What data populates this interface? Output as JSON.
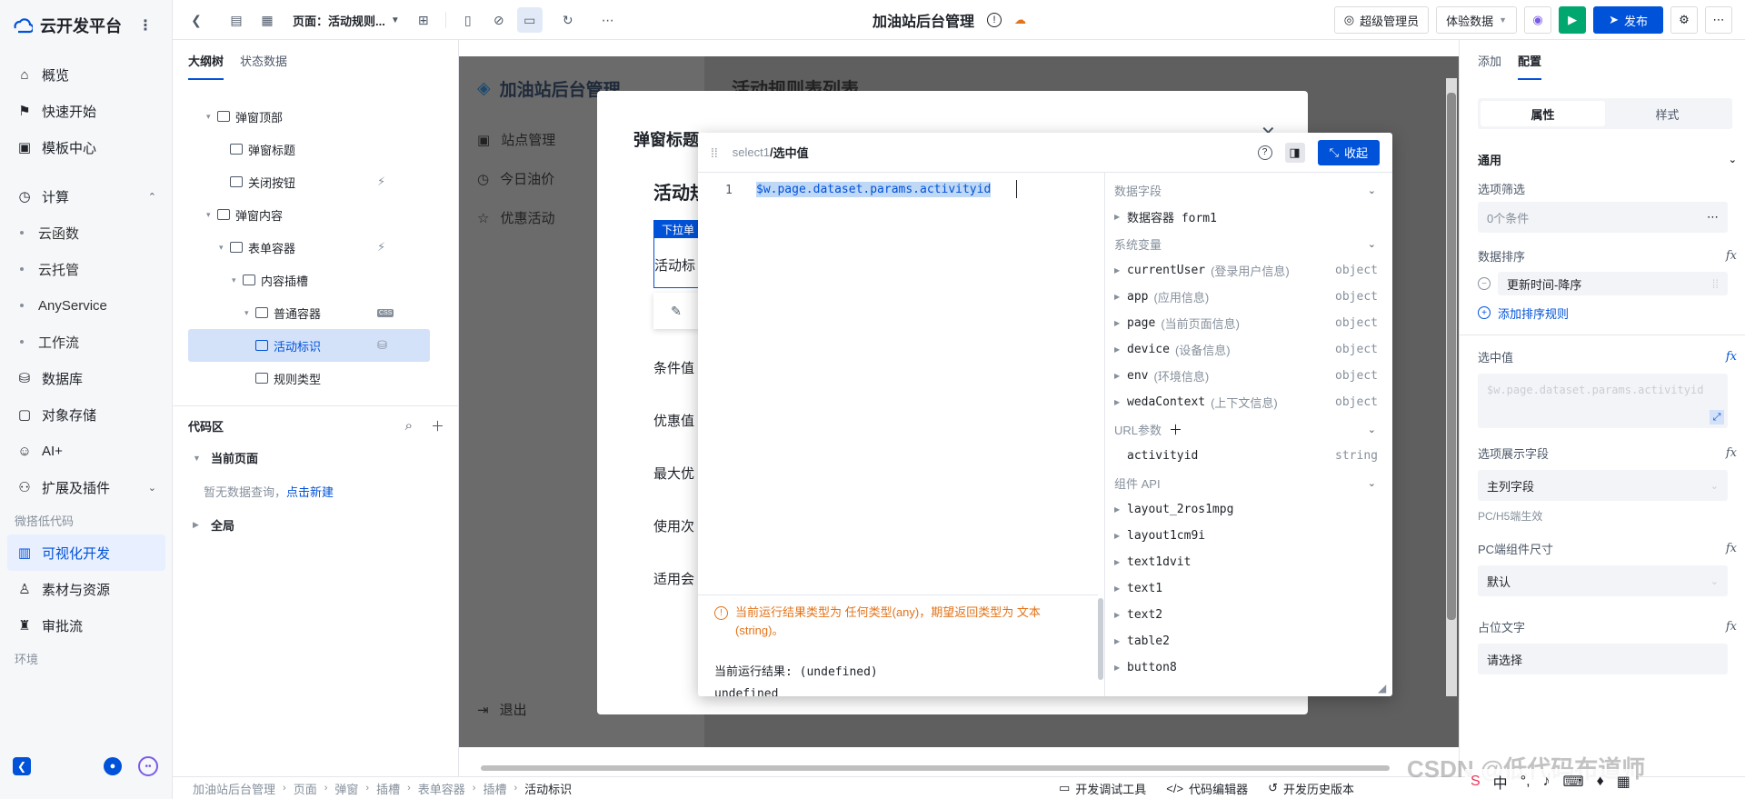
{
  "app": {
    "name": "云开发平台"
  },
  "nav": {
    "items": [
      {
        "label": "概览",
        "icon": "home-icon"
      },
      {
        "label": "快速开始",
        "icon": "flag-icon"
      },
      {
        "label": "模板中心",
        "icon": "template-icon"
      }
    ],
    "compute": {
      "label": "计算",
      "icon": "compute-icon"
    },
    "compute_sub": [
      "云函数",
      "云托管",
      "AnyService",
      "工作流"
    ],
    "items2": [
      {
        "label": "数据库",
        "icon": "database-icon"
      },
      {
        "label": "对象存储",
        "icon": "storage-icon"
      },
      {
        "label": "AI+",
        "icon": "robot-icon"
      },
      {
        "label": "扩展及插件",
        "icon": "plugin-icon"
      }
    ],
    "section_lowcode": "微搭低代码",
    "lowcode": [
      {
        "label": "可视化开发",
        "icon": "layout-icon",
        "active": true
      },
      {
        "label": "素材与资源",
        "icon": "user-icon"
      },
      {
        "label": "审批流",
        "icon": "stamp-icon"
      }
    ],
    "section_env": "环境"
  },
  "toolbar": {
    "page_label": "页面：活动规则...",
    "title": "加油站后台管理",
    "user_label": "超级管理员",
    "data_label": "体验数据",
    "publish_label": "发布"
  },
  "outline": {
    "tabs": [
      "大纲树",
      "状态数据"
    ],
    "tree": [
      {
        "label": "弹窗顶部",
        "indent": 0,
        "caret": true
      },
      {
        "label": "弹窗标题",
        "indent": 1,
        "caret": false
      },
      {
        "label": "关闭按钮",
        "indent": 1,
        "caret": false,
        "badge": "bolt"
      },
      {
        "label": "弹窗内容",
        "indent": 0,
        "caret": true
      },
      {
        "label": "表单容器",
        "indent": 1,
        "caret": true,
        "badge": "bolt"
      },
      {
        "label": "内容插槽",
        "indent": 2,
        "caret": true
      },
      {
        "label": "普通容器",
        "indent": 3,
        "caret": true,
        "badge": "css"
      },
      {
        "label": "活动标识",
        "indent": 3,
        "caret": false,
        "badge": "db",
        "selected": true
      },
      {
        "label": "规则类型",
        "indent": 3,
        "caret": false
      }
    ],
    "code_title": "代码区",
    "current_page": "当前页面",
    "empty_text": "暂无数据查询，",
    "create_link": "点击新建",
    "global": "全局"
  },
  "canvas": {
    "app_name": "加油站后台管理",
    "menu": [
      "站点管理",
      "今日油价",
      "优惠活动"
    ],
    "logout": "退出",
    "page_title": "活动规则表列表",
    "modal_title": "弹窗标题",
    "form_title": "活动规",
    "select_tag": "下拉单",
    "field_active": "活动标",
    "field_rows": [
      "条件值",
      "优惠值",
      "最大优",
      "使用次",
      "适用会"
    ]
  },
  "expr": {
    "breadcrumb_prefix": "select1",
    "breadcrumb_current": "选中值",
    "collapse_label": "收起",
    "line_no": "1",
    "code": "$w.page.dataset.params.activityid",
    "warning": "当前运行结果类型为 任何类型(any)，期望返回类型为 文本(string)。",
    "result_label": "当前运行结果: (undefined)",
    "result_value": "undefined",
    "data_fields_title": "数据字段",
    "data_container": "数据容器 form1",
    "sysvar_title": "系统变量",
    "sysvars": [
      {
        "name": "currentUser",
        "desc": "(登录用户信息)",
        "type": "object"
      },
      {
        "name": "app",
        "desc": "(应用信息)",
        "type": "object"
      },
      {
        "name": "page",
        "desc": "(当前页面信息)",
        "type": "object"
      },
      {
        "name": "device",
        "desc": "(设备信息)",
        "type": "object"
      },
      {
        "name": "env",
        "desc": "(环境信息)",
        "type": "object"
      },
      {
        "name": "wedaContext",
        "desc": "(上下文信息)",
        "type": "object"
      }
    ],
    "url_title": "URL参数",
    "url_params": [
      {
        "name": "activityid",
        "type": "string"
      }
    ],
    "api_title": "组件 API",
    "apis": [
      "layout_2ros1mpg",
      "layout1cm9i",
      "text1dvit",
      "text1",
      "text2",
      "table2",
      "button8"
    ]
  },
  "rpanel": {
    "tabs": [
      "添加",
      "配置"
    ],
    "seg": [
      "属性",
      "样式"
    ],
    "section": "通用",
    "filter_label": "选项筛选",
    "filter_value": "0个条件",
    "sort_label": "数据排序",
    "sort_value": "更新时间-降序",
    "add_sort": "添加排序规则",
    "selected_label": "选中值",
    "selected_value": "$w.page.dataset.params.activityid",
    "display_label": "选项展示字段",
    "display_value": "主列字段",
    "pc_note": "PC/H5端生效",
    "size_label": "PC端组件尺寸",
    "size_value": "默认",
    "placeholder_label": "占位文字",
    "placeholder_value": "请选择",
    "fx": "fx"
  },
  "bottom": {
    "crumbs": [
      "加油站后台管理",
      "页面",
      "弹窗",
      "插槽",
      "表单容器",
      "插槽",
      "活动标识"
    ],
    "tools": [
      "开发调试工具",
      "代码编辑器",
      "开发历史版本"
    ]
  },
  "watermark": "CSDN @低代码布道师"
}
